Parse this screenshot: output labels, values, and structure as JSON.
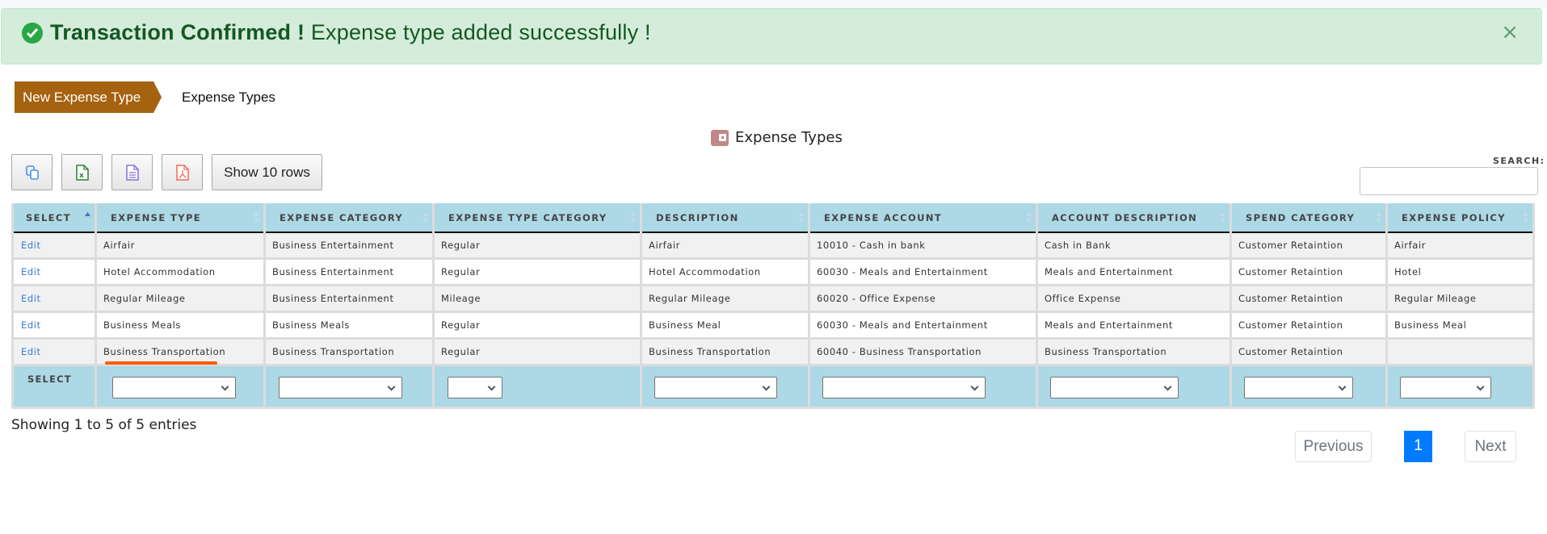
{
  "alert": {
    "title": "Transaction Confirmed !",
    "message": " Expense type added successfully !",
    "close": "×",
    "icon": "check-circle-icon"
  },
  "breadcrumb": {
    "active": "New Expense Type",
    "next": "Expense Types"
  },
  "table_title": "Expense Types",
  "toolbar": {
    "copy_icon": "copy-icon",
    "excel_icon": "excel-icon",
    "csv_icon": "csv-icon",
    "pdf_icon": "pdf-icon",
    "show_rows": "Show 10 rows"
  },
  "search": {
    "label": "SEARCH:",
    "value": "",
    "placeholder": ""
  },
  "columns": [
    "SELECT",
    "EXPENSE TYPE",
    "EXPENSE CATEGORY",
    "EXPENSE TYPE CATEGORY",
    "DESCRIPTION",
    "EXPENSE ACCOUNT",
    "ACCOUNT DESCRIPTION",
    "SPEND CATEGORY",
    "EXPENSE POLICY"
  ],
  "rows": [
    [
      "Edit",
      "Airfair",
      "Business Entertainment",
      "Regular",
      "Airfair",
      "10010 - Cash in bank",
      "Cash in Bank",
      "Customer Retaintion",
      "Airfair"
    ],
    [
      "Edit",
      "Hotel Accommodation",
      "Business Entertainment",
      "Regular",
      "Hotel Accommodation",
      "60030 - Meals and Entertainment",
      "Meals and Entertainment",
      "Customer Retaintion",
      "Hotel"
    ],
    [
      "Edit",
      "Regular Mileage",
      "Business Entertainment",
      "Mileage",
      "Regular Mileage",
      "60020 - Office Expense",
      "Office Expense",
      "Customer Retaintion",
      "Regular Mileage"
    ],
    [
      "Edit",
      "Business Meals",
      "Business Meals",
      "Regular",
      "Business Meal",
      "60030 - Meals and Entertainment",
      "Meals and Entertainment",
      "Customer Retaintion",
      "Business Meal"
    ],
    [
      "Edit",
      "Business Transportation",
      "Business Transportation",
      "Regular",
      "Business Transportation",
      "60040 - Business Transportation",
      "Business Transportation",
      "Customer Retaintion",
      ""
    ]
  ],
  "footer": {
    "label": "SELECT",
    "filters": [
      "",
      "",
      "",
      "",
      "",
      "",
      "",
      ""
    ]
  },
  "info": "Showing 1 to 5 of 5 entries",
  "pagination": {
    "previous": "Previous",
    "current": "1",
    "next": "Next"
  },
  "colors": {
    "alert_bg": "#d4edda",
    "alert_text": "#155724",
    "breadcrumb_active": "#a5620f",
    "table_header": "#add8e6",
    "link": "#3a7bd5",
    "page_active": "#007bff",
    "highlight_underline": "#ff5a0a"
  }
}
